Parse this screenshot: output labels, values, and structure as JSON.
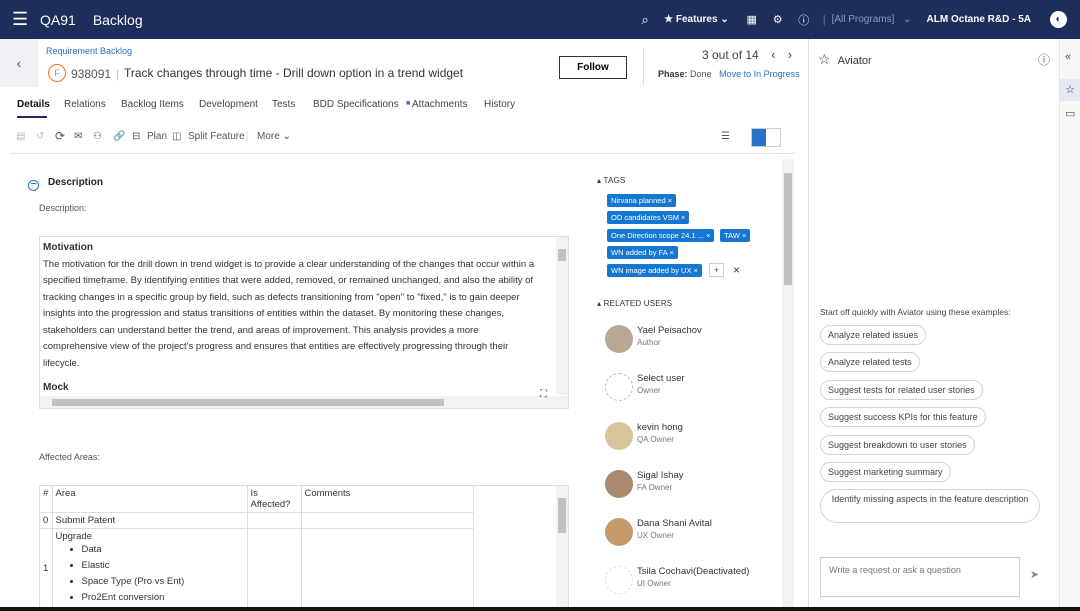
{
  "topbar": {
    "workspace": "QA91",
    "title": "Backlog",
    "features": "Features",
    "programs": "[All Programs]",
    "space": "ALM Octane R&D - 5A"
  },
  "entity": {
    "breadcrumb": "Requirement Backlog",
    "type_letter": "F",
    "id": "938091",
    "name": "Track changes through time - Drill down option in a trend widget",
    "follow": "Follow",
    "pager": "3 out of 14",
    "phase_label": "Phase:",
    "phase_value": "Done",
    "move": "Move to In Progress"
  },
  "tabs": [
    "Details",
    "Relations",
    "Backlog Items",
    "Development",
    "Tests",
    "BDD Specifications",
    "Attachments",
    "History"
  ],
  "toolbar": {
    "plan": "Plan",
    "split": "Split Feature",
    "more": "More"
  },
  "description": {
    "heading": "Description",
    "label": "Description:",
    "motivation_title": "Motivation",
    "motivation_lines": [
      "The motivation for the drill down in trend widget is to provide a clear understanding of the changes that occur within a",
      "specified timeframe. By identifying entities that were added, removed, or remained unchanged, and also the ability of",
      "tracking changes in a specific group by field, such as defects transitioning from \"open\" to \"fixed,\" is to gain deeper",
      "insights into the progression and status transitions of entities within the dataset. By monitoring these changes,",
      "stakeholders can understand better the trend, and areas of improvement. This analysis provides a more",
      "comprehensive view of the project's progress and ensures that entities are effectively progressing through their",
      "lifecycle."
    ],
    "cut_line": "Mock"
  },
  "affected": {
    "label": "Affected Areas:",
    "headers": [
      "#",
      "Area",
      "Is Affected?",
      "Comments"
    ],
    "rows": [
      {
        "n": "0",
        "area": "Submit Patent"
      },
      {
        "n": "1",
        "area": "Upgrade",
        "items": [
          "Data",
          "Elastic",
          "Space Type (Pro vs Ent)",
          "Pro2Ent conversion"
        ]
      }
    ]
  },
  "tags": {
    "title": "TAGS",
    "items": [
      "Nirvana planned",
      "OD candidates VSM",
      "One Direction scope 24.1 ...",
      "TAW",
      "WN added by FA",
      "WN image added by UX"
    ]
  },
  "related": {
    "title": "RELATED USERS",
    "users": [
      {
        "name": "Yael Peisachov",
        "role": "Author"
      },
      {
        "name": "Select user",
        "role": "Owner"
      },
      {
        "name": "kevin hong",
        "role": "QA Owner"
      },
      {
        "name": "Sigal Ishay",
        "role": "FA Owner"
      },
      {
        "name": "Dana Shani Avital",
        "role": "UX Owner"
      },
      {
        "name": "Tsila Cochavi(Deactivated)",
        "role": "UI Owner"
      }
    ]
  },
  "aviator": {
    "title": "Aviator",
    "starter": "Start off quickly with Aviator using these examples:",
    "suggestions": [
      "Analyze related issues",
      "Analyze related tests",
      "Suggest tests for related user stories",
      "Suggest success KPIs for this feature",
      "Suggest breakdown to user stories",
      "Suggest marketing summary",
      "Identify missing aspects in the feature description"
    ],
    "placeholder": "Write a request or ask a question"
  },
  "colors": {
    "topbar": "#1d2d5c",
    "accent": "#2a6fc9",
    "tag": "#1677d2",
    "feature_badge": "#e8762c"
  }
}
